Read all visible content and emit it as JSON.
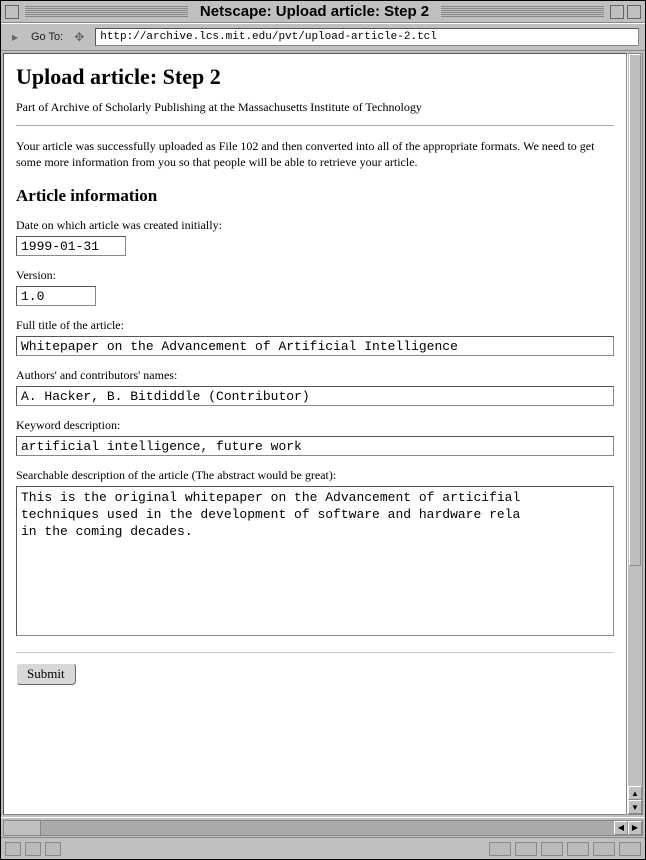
{
  "window": {
    "title": "Netscape: Upload article: Step 2"
  },
  "toolbar": {
    "goto_label": "Go To:",
    "url": "http://archive.lcs.mit.edu/pvt/upload-article-2.tcl"
  },
  "page": {
    "heading": "Upload article: Step 2",
    "subtitle": "Part of Archive of Scholarly Publishing at the Massachusetts Institute of Technology",
    "intro": "Your article was successfully uploaded as File 102 and then converted into all of the appropriate formats. We need to get some more information from you so that people will be able to retrieve your article.",
    "section_heading": "Article information"
  },
  "form": {
    "date_label": "Date on which article was created initially:",
    "date_value": "1999-01-31",
    "version_label": "Version:",
    "version_value": "1.0",
    "title_label": "Full title of the article:",
    "title_value": "Whitepaper on the Advancement of Artificial Intelligence",
    "authors_label": "Authors' and contributors' names:",
    "authors_value": "A. Hacker, B. Bitdiddle (Contributor)",
    "keywords_label": "Keyword description:",
    "keywords_value": "artificial intelligence, future work",
    "description_label": "Searchable description of the article (The abstract would be great):",
    "description_value": "This is the original whitepaper on the Advancement of articifial\ntechniques used in the development of software and hardware rela\nin the coming decades.",
    "submit_label": "Submit"
  }
}
